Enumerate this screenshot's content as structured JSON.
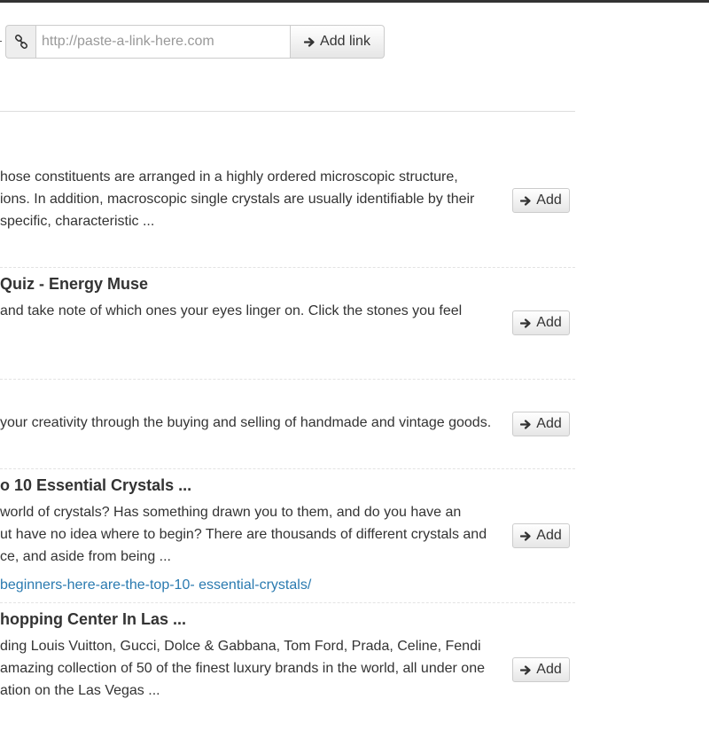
{
  "toolbar": {
    "url_placeholder": "http://paste-a-link-here.com",
    "add_link_label": "Add link",
    "link_icon": "chain-link-icon",
    "arrow_icon": "arrow-right-icon"
  },
  "results": [
    {
      "title": "",
      "snippet_lines": [
        "hose constituents are arranged in a highly ordered microscopic structure,",
        "ions. In addition, macroscopic single crystals are usually identifiable by their",
        "specific, characteristic ..."
      ],
      "url": "",
      "add_label": "Add"
    },
    {
      "title": "Quiz - Energy Muse",
      "snippet_lines": [
        "and take note of which ones your eyes linger on. Click the stones you feel"
      ],
      "url": "",
      "add_label": "Add"
    },
    {
      "title": "",
      "snippet_lines": [
        "your creativity through the buying and selling of handmade and vintage goods."
      ],
      "url": "",
      "add_label": "Add"
    },
    {
      "title": "o 10 Essential Crystals ...",
      "snippet_lines": [
        "world of crystals? Has something drawn you to them, and do you have an",
        "ut have no idea where to begin? There are thousands of different crystals and",
        "ce, and aside from being ..."
      ],
      "url": "beginners-here-are-the-top-10- essential-crystals/",
      "add_label": "Add"
    },
    {
      "title": "hopping Center In Las ...",
      "snippet_lines": [
        "ding Louis Vuitton, Gucci, Dolce & Gabbana, Tom Ford, Prada, Celine, Fendi",
        "amazing collection of 50 of the finest luxury brands in the world, all under one",
        "ation on the Las Vegas  ..."
      ],
      "url": "",
      "add_label": "Add"
    }
  ]
}
